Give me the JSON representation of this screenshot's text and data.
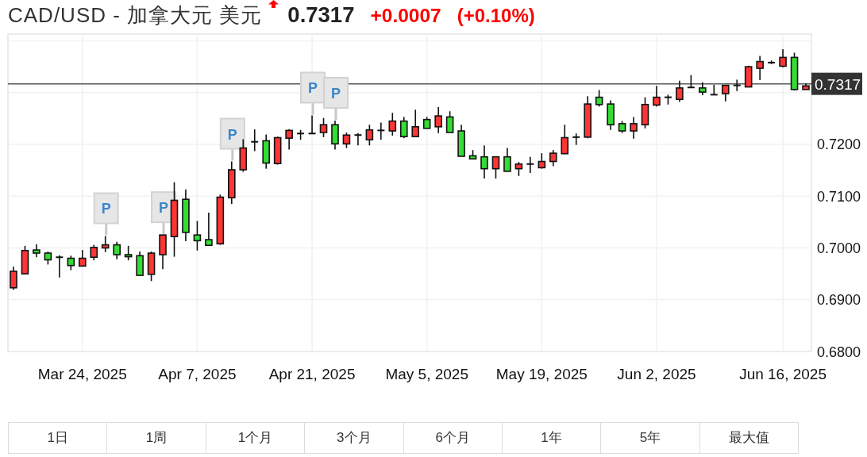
{
  "quote": {
    "title": "CAD/USD - 加拿大元 美元",
    "rising": true,
    "price": "0.7317",
    "change": "+0.0007",
    "change_percent": "(+0.10%)"
  },
  "chart": {
    "chart_data": {
      "type": "candlestick",
      "grid": true,
      "ylim": [
        0.68,
        0.7413
      ],
      "yticks": [
        {
          "value": 0.68,
          "label": "0.6800"
        },
        {
          "value": 0.69,
          "label": "0.6900"
        },
        {
          "value": 0.7,
          "label": "0.7000"
        },
        {
          "value": 0.71,
          "label": "0.7100"
        },
        {
          "value": 0.72,
          "label": "0.7200"
        }
      ],
      "categories": [
        null,
        null,
        null,
        null,
        null,
        null,
        "Mar 24, 2025",
        null,
        null,
        null,
        null,
        null,
        null,
        null,
        null,
        null,
        "Apr 7, 2025",
        null,
        null,
        null,
        null,
        null,
        null,
        null,
        null,
        null,
        "Apr 21, 2025",
        null,
        null,
        null,
        null,
        null,
        null,
        null,
        null,
        null,
        "May 5, 2025",
        null,
        null,
        null,
        null,
        null,
        null,
        null,
        null,
        null,
        "May 19, 2025",
        null,
        null,
        null,
        null,
        null,
        null,
        null,
        null,
        null,
        "Jun 2, 2025",
        null,
        null,
        null,
        null,
        null,
        null,
        null,
        null,
        null,
        null,
        "Jun 16, 2025",
        null,
        null
      ],
      "ohlc": [
        [
          0.6923,
          0.6964,
          0.6919,
          0.6955
        ],
        [
          0.695,
          0.7004,
          0.695,
          0.6995
        ],
        [
          0.6996,
          0.7007,
          0.6982,
          0.699
        ],
        [
          0.699,
          0.6993,
          0.6968,
          0.6977
        ],
        [
          0.6982,
          0.6986,
          0.6943,
          0.6982
        ],
        [
          0.698,
          0.6985,
          0.6957,
          0.6966
        ],
        [
          0.6965,
          0.6996,
          0.6965,
          0.698
        ],
        [
          0.6982,
          0.7006,
          0.6976,
          0.7001
        ],
        [
          0.7,
          0.7023,
          0.6992,
          0.7006
        ],
        [
          0.7006,
          0.7012,
          0.6978,
          0.6987
        ],
        [
          0.6987,
          0.7004,
          0.6976,
          0.6983
        ],
        [
          0.6985,
          0.6993,
          0.6947,
          0.6947
        ],
        [
          0.6949,
          0.6993,
          0.6936,
          0.699
        ],
        [
          0.6987,
          0.7025,
          0.6959,
          0.7025
        ],
        [
          0.7022,
          0.7127,
          0.6983,
          0.7092
        ],
        [
          0.7094,
          0.7113,
          0.7013,
          0.703
        ],
        [
          0.7025,
          0.7052,
          0.6995,
          0.7014
        ],
        [
          0.7016,
          0.7068,
          0.7005,
          0.7005
        ],
        [
          0.7008,
          0.7103,
          0.7006,
          0.7098
        ],
        [
          0.7097,
          0.7167,
          0.7085,
          0.7151
        ],
        [
          0.7151,
          0.721,
          0.7147,
          0.7193
        ],
        [
          0.7205,
          0.7229,
          0.7187,
          0.7205
        ],
        [
          0.7207,
          0.7219,
          0.7153,
          0.7164
        ],
        [
          0.7163,
          0.7215,
          0.7161,
          0.7213
        ],
        [
          0.7212,
          0.7229,
          0.719,
          0.7227
        ],
        [
          0.7221,
          0.7228,
          0.7209,
          0.7221
        ],
        [
          0.7221,
          0.7256,
          0.7221,
          0.7221
        ],
        [
          0.7223,
          0.7251,
          0.7214,
          0.7238
        ],
        [
          0.7238,
          0.7246,
          0.719,
          0.7201
        ],
        [
          0.7201,
          0.7223,
          0.7193,
          0.7218
        ],
        [
          0.7218,
          0.7222,
          0.7198,
          0.7218
        ],
        [
          0.7209,
          0.7238,
          0.7198,
          0.7228
        ],
        [
          0.7227,
          0.7242,
          0.7209,
          0.7227
        ],
        [
          0.7226,
          0.7261,
          0.7217,
          0.7245
        ],
        [
          0.7245,
          0.7253,
          0.7212,
          0.7215
        ],
        [
          0.7215,
          0.7267,
          0.7215,
          0.7234
        ],
        [
          0.7248,
          0.7253,
          0.7231,
          0.7231
        ],
        [
          0.7234,
          0.7272,
          0.7222,
          0.7255
        ],
        [
          0.7253,
          0.7264,
          0.7223,
          0.7223
        ],
        [
          0.7226,
          0.7238,
          0.7177,
          0.7177
        ],
        [
          0.7178,
          0.7189,
          0.7172,
          0.7172
        ],
        [
          0.7176,
          0.7198,
          0.7134,
          0.7153
        ],
        [
          0.7153,
          0.7177,
          0.7134,
          0.7176
        ],
        [
          0.7176,
          0.7193,
          0.7148,
          0.7148
        ],
        [
          0.7153,
          0.7166,
          0.7139,
          0.7162
        ],
        [
          0.7162,
          0.7176,
          0.7145,
          0.7162
        ],
        [
          0.7155,
          0.7183,
          0.7153,
          0.7167
        ],
        [
          0.7167,
          0.7189,
          0.7158,
          0.7183
        ],
        [
          0.7182,
          0.7238,
          0.7182,
          0.7213
        ],
        [
          0.7214,
          0.7221,
          0.7199,
          0.7214
        ],
        [
          0.7214,
          0.7293,
          0.7212,
          0.7278
        ],
        [
          0.7291,
          0.7305,
          0.7273,
          0.7277
        ],
        [
          0.7278,
          0.7285,
          0.7228,
          0.7238
        ],
        [
          0.724,
          0.7245,
          0.7222,
          0.7226
        ],
        [
          0.7226,
          0.7253,
          0.7211,
          0.724
        ],
        [
          0.7238,
          0.7291,
          0.7231,
          0.7277
        ],
        [
          0.7276,
          0.7313,
          0.7273,
          0.7291
        ],
        [
          0.7291,
          0.7296,
          0.7277,
          0.7291
        ],
        [
          0.7287,
          0.7323,
          0.7282,
          0.7309
        ],
        [
          0.731,
          0.7334,
          0.7309,
          0.731
        ],
        [
          0.7309,
          0.732,
          0.7295,
          0.7301
        ],
        [
          0.7296,
          0.7315,
          0.7296,
          0.7296
        ],
        [
          0.7298,
          0.7314,
          0.7283,
          0.7314
        ],
        [
          0.7314,
          0.7325,
          0.7303,
          0.7314
        ],
        [
          0.7311,
          0.7352,
          0.7311,
          0.735
        ],
        [
          0.7347,
          0.7371,
          0.7324,
          0.736
        ],
        [
          0.7358,
          0.7362,
          0.7355,
          0.7358
        ],
        [
          0.7351,
          0.7384,
          0.7349,
          0.7368
        ],
        [
          0.7368,
          0.7377,
          0.7304,
          0.7306
        ],
        [
          0.7306,
          0.7318,
          0.7306,
          0.7313
        ]
      ],
      "ref_lines": [
        {
          "axis": "y",
          "value": 0.7317,
          "label": "0.7317"
        }
      ],
      "annotations": [
        {
          "y": 0.7023,
          "text": "P"
        },
        {
          "y": 0.7025,
          "text": "P"
        },
        {
          "y": 0.7167,
          "text": "P"
        },
        {
          "y": 0.7256,
          "text": "P"
        },
        {
          "y": 0.7246,
          "text": "P"
        }
      ]
    }
  },
  "ranges": [
    {
      "label": "1日",
      "selected": false
    },
    {
      "label": "1周",
      "selected": false
    },
    {
      "label": "1个月",
      "selected": false
    },
    {
      "label": "3个月",
      "selected": false
    },
    {
      "label": "6个月",
      "selected": false
    },
    {
      "label": "1年",
      "selected": false
    },
    {
      "label": "5年",
      "selected": false
    },
    {
      "label": "最大值",
      "selected": false
    }
  ]
}
